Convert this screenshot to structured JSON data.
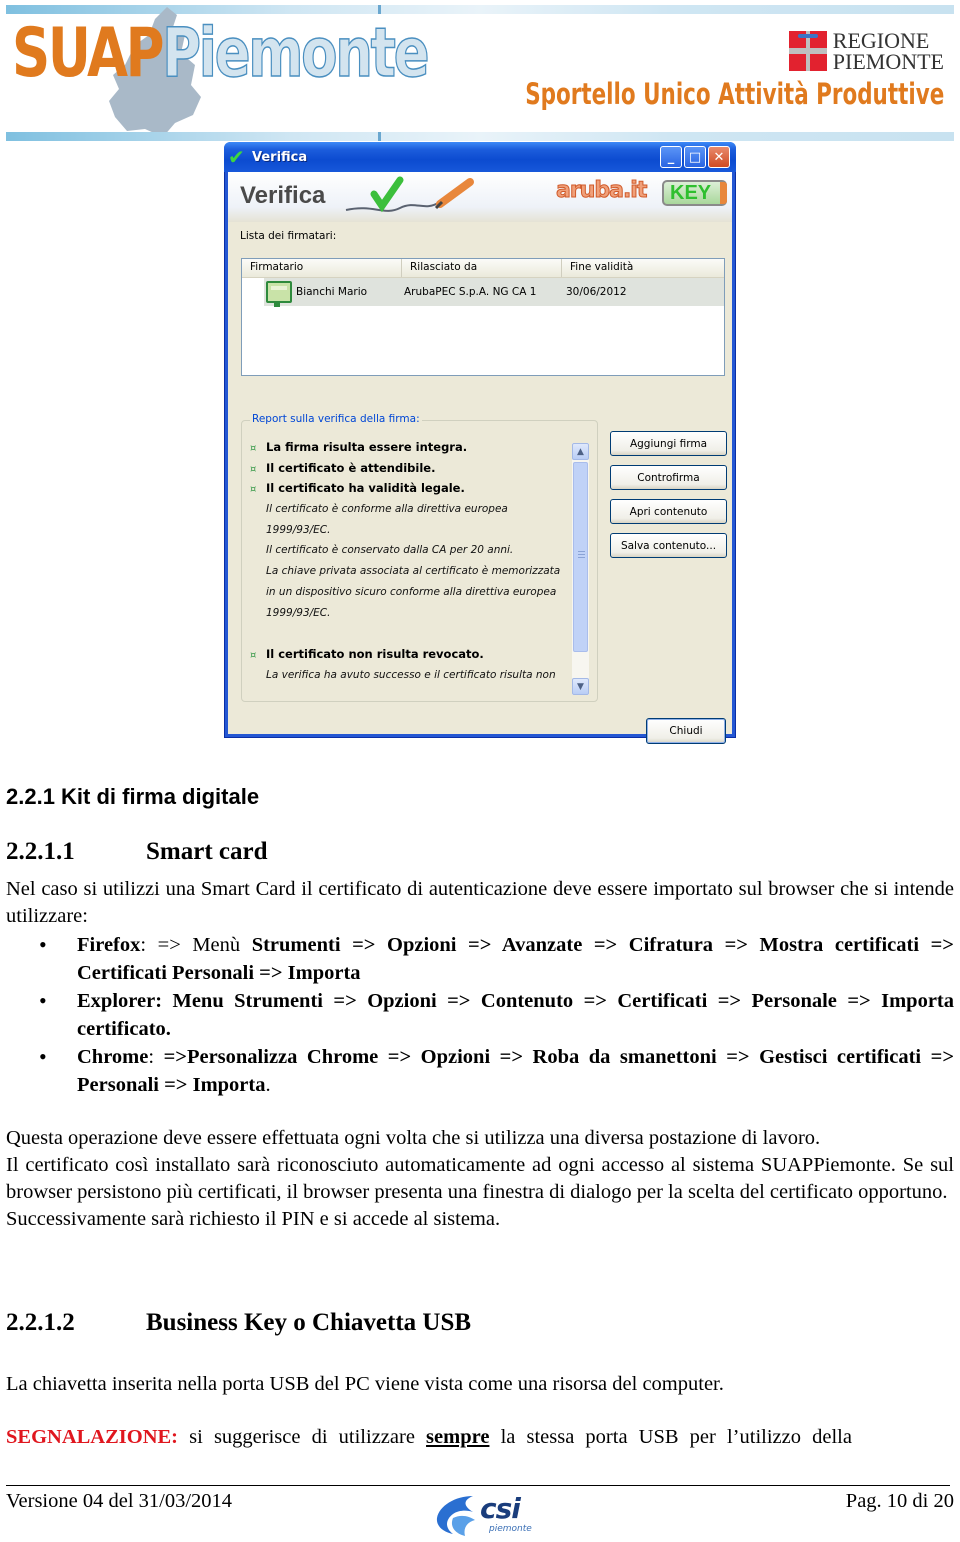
{
  "header": {
    "logo_left": {
      "orange_part": "SUAP",
      "blue_part": "iemonte"
    },
    "region_logo_line1": "REGIONE",
    "region_logo_line2": "PIEMONTE",
    "tagline": "Sportello Unico Attività Produttive",
    "colors": {
      "orange": "#e07a1e",
      "blue_outline": "#4a8fc0",
      "red": "#e2222f"
    }
  },
  "dialog": {
    "window_title": "Verifica",
    "header_title": "Verifica",
    "brand": "aruba.it",
    "brand_badge": "KEY",
    "title_buttons": {
      "minimize": "_",
      "maximize": "□",
      "close": "✕"
    },
    "signers_label": "Lista dei firmatari:",
    "signers_table": {
      "columns": [
        "Firmatario",
        "Rilasciato da",
        "Fine validità"
      ],
      "rows": [
        {
          "signer": "Bianchi Mario",
          "issuer": "ArubaPEC S.p.A. NG CA 1",
          "expiry": "30/06/2012"
        }
      ]
    },
    "report_label": "Report sulla verifica della firma:",
    "report_lines": [
      {
        "style": "bold",
        "text": "La firma risulta essere integra."
      },
      {
        "style": "bold",
        "text": "Il certificato è attendibile."
      },
      {
        "style": "bold",
        "text": "Il certificato ha validità legale."
      },
      {
        "style": "italic",
        "text": "Il certificato è conforme alla direttiva europea"
      },
      {
        "style": "italic",
        "text": "1999/93/EC."
      },
      {
        "style": "italic",
        "text": "Il certificato è conservato dalla CA per 20 anni."
      },
      {
        "style": "italic",
        "text": "La chiave privata associata al certificato è memorizzata"
      },
      {
        "style": "italic",
        "text": "in un dispositivo sicuro conforme alla direttiva europea"
      },
      {
        "style": "italic",
        "text": "1999/93/EC."
      },
      {
        "style": "blank",
        "text": ""
      },
      {
        "style": "bold",
        "text": "Il certificato non risulta revocato."
      },
      {
        "style": "italic",
        "text": "La verifica ha avuto successo e il certificato risulta non"
      }
    ],
    "report_bullet_symbol": "¤",
    "scroll_position": 0.0,
    "buttons": {
      "add_signature": "Aggiungi firma",
      "countersign": "Controfirma",
      "open_content": "Apri contenuto",
      "save_content": "Salva contenuto...",
      "close": "Chiudi"
    }
  },
  "document": {
    "h2": "2.2.1  Kit di firma digitale",
    "section_smartcard": {
      "number": "2.2.1.1",
      "title": "Smart card"
    },
    "intro": "Nel caso si utilizzi una Smart Card il certificato di autenticazione deve essere importato sul browser che si intende utilizzare:",
    "bullets": [
      {
        "label": "Firefox",
        "sep": ": => Menù ",
        "path": "Strumenti => Opzioni => Avanzate => Cifratura => Mostra certificati => Certificati Personali => Importa",
        "tail": ""
      },
      {
        "label": "Explorer:",
        "sep": " ",
        "path": "Menu Strumenti => Opzioni => Contenuto => Certificati => Personale => Importa certificato.",
        "tail": ""
      },
      {
        "label": "Chrome",
        "sep": ": ",
        "path": "=>Personalizza Chrome => Opzioni => Roba da smanettoni => Gestisci certificati => Personali => Importa",
        "tail": "."
      }
    ],
    "para_after": [
      "Questa operazione deve essere effettuata ogni volta che si utilizza una diversa postazione di lavoro.",
      "Il certificato così installato sarà riconosciuto automaticamente ad ogni accesso al sistema SUAPPiemonte. Se sul browser persistono più certificati, il browser presenta una finestra di dialogo per la scelta del certificato opportuno.",
      "Successivamente sarà richiesto il PIN e si accede al sistema."
    ],
    "section_usb": {
      "number": "2.2.1.2",
      "title": "Business Key o Chiavetta USB"
    },
    "usb_para": "La chiavetta inserita nella porta USB del PC viene vista come una risorsa del computer.",
    "warning": {
      "label": "SEGNALAZIONE:",
      "before": " si suggerisce di utilizzare ",
      "emphasis": "sempre",
      "after": " la stessa porta USB per l’utilizzo della",
      "color": "#e0161e"
    }
  },
  "footer": {
    "version": "Versione 04 del 31/03/2014",
    "logo_word": "csi",
    "logo_sub": "piemonte",
    "page": "Pag. 10 di 20"
  }
}
